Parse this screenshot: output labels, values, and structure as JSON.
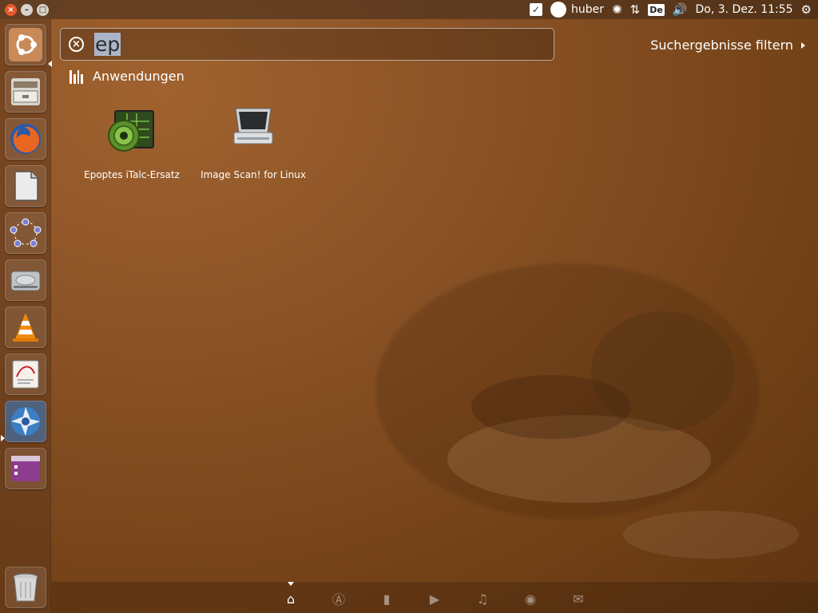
{
  "top_panel": {
    "window_buttons": [
      "close-icon",
      "minimize-icon",
      "maximize-icon"
    ],
    "user": "huber",
    "keyboard_layout": "De",
    "clock": "Do,  3. Dez. 11:55"
  },
  "launcher": {
    "items": [
      {
        "name": "dash-home-button",
        "icon": "ubuntu-logo-icon",
        "color": "#c98a5a"
      },
      {
        "name": "files-launcher",
        "icon": "file-cabinet-icon",
        "color": "#d9d4cc"
      },
      {
        "name": "firefox-launcher",
        "icon": "firefox-icon",
        "color": "#e8661f"
      },
      {
        "name": "libreoffice-launcher",
        "icon": "document-icon",
        "color": "#ebebeb"
      },
      {
        "name": "network-launcher",
        "icon": "network-nodes-icon",
        "color": "#cfd3e8"
      },
      {
        "name": "disk-launcher",
        "icon": "hard-disk-icon",
        "color": "#bfc3c6"
      },
      {
        "name": "vlc-launcher",
        "icon": "vlc-cone-icon",
        "color": "#f08a0c"
      },
      {
        "name": "pdf-launcher",
        "icon": "pdf-viewer-icon",
        "color": "#f4f0ea"
      },
      {
        "name": "shutter-launcher",
        "icon": "aperture-icon",
        "color": "#3c7ec4"
      },
      {
        "name": "window-launcher",
        "icon": "window-purple-icon",
        "color": "#8e3c8f"
      },
      {
        "name": "trash-launcher",
        "icon": "trash-icon",
        "color": "#c9c9c9"
      }
    ]
  },
  "dash": {
    "search_query": "ep",
    "filter_label": "Suchergebnisse filtern",
    "category": "Anwendungen",
    "results": [
      {
        "label": "Epoptes iTalc-Ersatz",
        "icon": "epoptes-icon"
      },
      {
        "label": "Image Scan! for Linux",
        "icon": "scanner-icon"
      }
    ],
    "lenses": [
      "home-lens-icon",
      "applications-lens-icon",
      "files-lens-icon",
      "video-lens-icon",
      "music-lens-icon",
      "photo-lens-icon",
      "social-lens-icon"
    ]
  },
  "colors": {
    "accent": "#e5582a",
    "selection": "#b4c8e6",
    "wallpaper": "#8a5226"
  }
}
